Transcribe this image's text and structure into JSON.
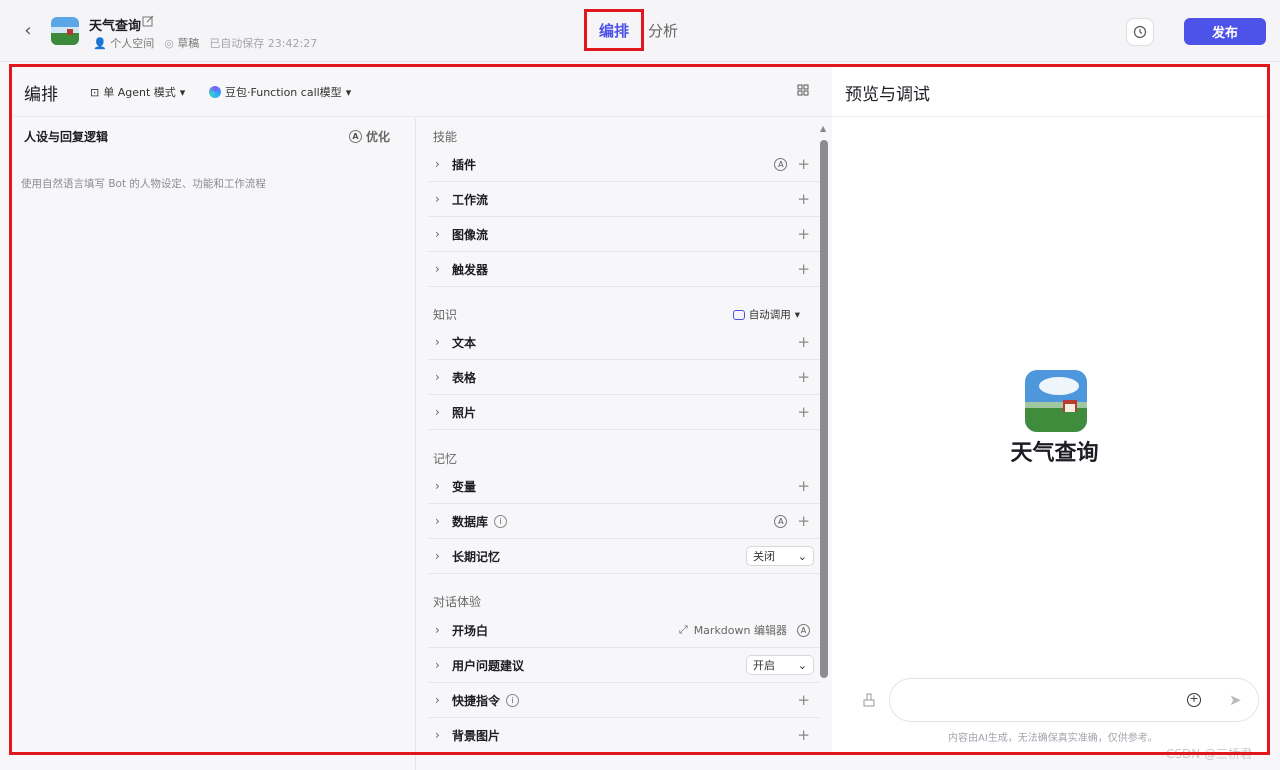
{
  "header": {
    "bot_name": "天气查询",
    "workspace": "个人空间",
    "status": "草稿",
    "autosave": "已自动保存 23:42:27",
    "tab_active": "编排",
    "tab_other": "分析",
    "publish_label": "发布"
  },
  "left": {
    "title": "编排",
    "mode_label": "单 Agent 模式",
    "model_label": "豆包·Function call模型",
    "persona_title": "人设与回复逻辑",
    "optimize_label": "优化",
    "persona_placeholder": "使用自然语言填写 Bot 的人物设定、功能和工作流程"
  },
  "skills": {
    "section_skills": "技能",
    "plugin": "插件",
    "workflow": "工作流",
    "imageflow": "图像流",
    "trigger": "触发器",
    "section_knowledge": "知识",
    "auto_call": "自动调用",
    "text": "文本",
    "table": "表格",
    "photo": "照片",
    "section_memory": "记忆",
    "variable": "变量",
    "database": "数据库",
    "longterm": "长期记忆",
    "longterm_value": "关闭",
    "section_dialog": "对话体验",
    "opening": "开场白",
    "markdown_editor": "Markdown 编辑器",
    "question_suggest": "用户问题建议",
    "question_suggest_value": "开启",
    "shortcut": "快捷指令",
    "background": "背景图片"
  },
  "right": {
    "title": "预览与调试",
    "bot_name": "天气查询",
    "disclaimer": "内容由AI生成，无法确保真实准确，仅供参考。"
  },
  "watermark": "CSDN @三桥君"
}
